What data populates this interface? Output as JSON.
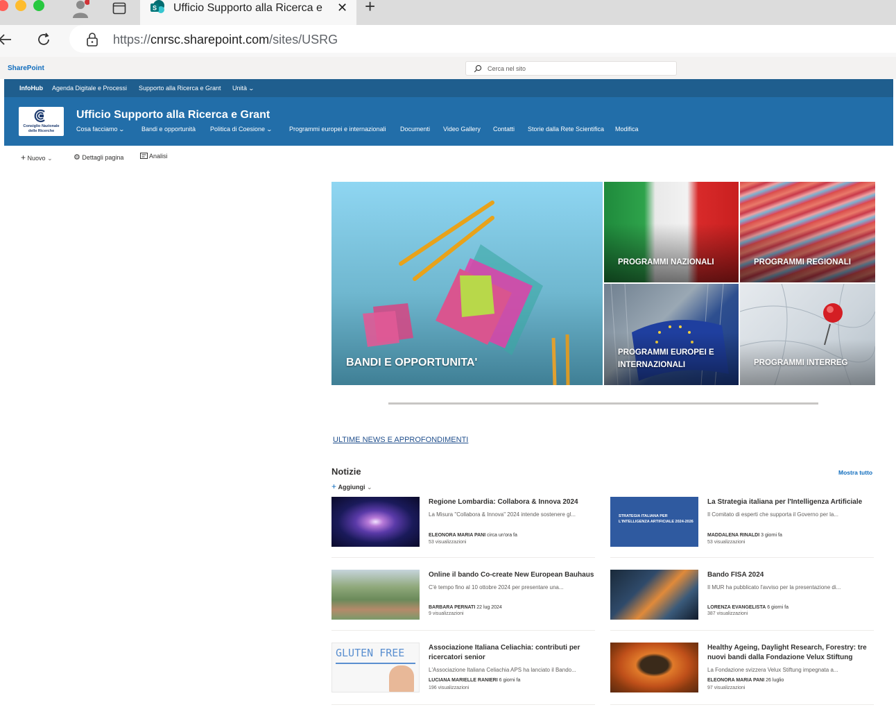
{
  "browser": {
    "tab_title": "Ufficio Supporto alla Ricerca e",
    "url_scheme": "https://",
    "url_host": "cnrsc.sharepoint.com",
    "url_path": "/sites/USRG"
  },
  "suite": {
    "brand": "SharePoint",
    "search_placeholder": "Cerca nel sito"
  },
  "hub": {
    "items": [
      "InfoHub",
      "Agenda Digitale e Processi",
      "Supporto alla Ricerca e Grant",
      "Unità"
    ]
  },
  "site": {
    "logo_line1": "Consiglio Nazionale",
    "logo_line2": "delle Ricerche",
    "title": "Ufficio Supporto alla Ricerca e Grant",
    "nav": [
      "Cosa facciamo",
      "Bandi e opportunità",
      "Politica di Coesione",
      "Programmi europei e internazionali",
      "Documenti",
      "Video Gallery",
      "Contatti",
      "Storie dalla Rete Scientifica",
      "Modifica"
    ]
  },
  "commands": {
    "new": "Nuovo",
    "page_details": "Dettagli pagina",
    "analytics": "Analisi"
  },
  "hero": {
    "main": "BANDI E OPPORTUNITA'",
    "tiles": [
      "PROGRAMMI NAZIONALI",
      "PROGRAMMI REGIONALI",
      "PROGRAMMI EUROPEI E INTERNAZIONALI",
      "PROGRAMMI INTERREG"
    ]
  },
  "section_link": "ULTIME NEWS E APPROFONDIMENTI",
  "news": {
    "heading": "Notizie",
    "add": "Aggiungi",
    "see_all": "Mostra tutto",
    "strategy_thumb_text": "STRATEGIA ITALIANA PER L'INTELLIGENZA ARTIFICIALE 2024-2026",
    "gluten_thumb_text": "GLUTEN FREE",
    "items": [
      {
        "title": "Regione Lombardia: Collabora & Innova 2024",
        "desc": "La Misura \"Collabora & Innova\" 2024 intende sostenere gl...",
        "author": "ELEONORA MARIA PANI",
        "when": "circa un'ora fa",
        "views": "53 visualizzazioni"
      },
      {
        "title": "La Strategia italiana per l'Intelligenza Artificiale",
        "desc": "Il Comitato di esperti che supporta il Governo per la...",
        "author": "MADDALENA RINALDI",
        "when": "3 giorni fa",
        "views": "53 visualizzazioni"
      },
      {
        "title": "Online il bando Co-create New European Bauhaus",
        "desc": "C'è tempo fino al 10 ottobre 2024 per presentare una...",
        "author": "BARBARA PERNATI",
        "when": "22 lug 2024",
        "views": "9 visualizzazioni"
      },
      {
        "title": "Bando FISA 2024",
        "desc": "Il MUR ha pubblicato l'avviso per la presentazione di...",
        "author": "LORENZA EVANGELISTA",
        "when": "6 giorni fa",
        "views": "387 visualizzazioni"
      },
      {
        "title": "Associazione Italiana Celiachia: contributi per ricercatori senior",
        "desc": "L'Associazione Italiana Celiachia APS ha lanciato il Bando...",
        "author": "LUCIANA MARIELLE RANIERI",
        "when": "6 giorni fa",
        "views": "196 visualizzazioni"
      },
      {
        "title": "Healthy Ageing, Daylight Research, Forestry: tre nuovi bandi dalla Fondazione Velux Stiftung",
        "desc": "La Fondazione svizzera Velux Stiftung impegnata a...",
        "author": "ELEONORA MARIA PANI",
        "when": "26 luglio",
        "views": "97 visualizzazioni"
      }
    ]
  }
}
